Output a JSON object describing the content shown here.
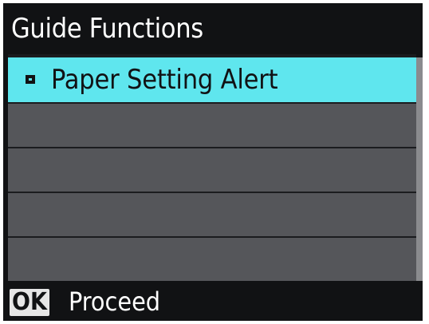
{
  "header": {
    "title": "Guide Functions"
  },
  "menu": {
    "items": [
      {
        "label": "Paper Setting Alert",
        "selected": true
      },
      {
        "label": "",
        "selected": false
      },
      {
        "label": "",
        "selected": false
      },
      {
        "label": "",
        "selected": false
      },
      {
        "label": "",
        "selected": false
      }
    ]
  },
  "footer": {
    "ok_key": "OK",
    "action_label": "Proceed"
  },
  "colors": {
    "selection_highlight": "#5fe6ee",
    "row_background": "#55565a",
    "screen_background": "#111214"
  }
}
